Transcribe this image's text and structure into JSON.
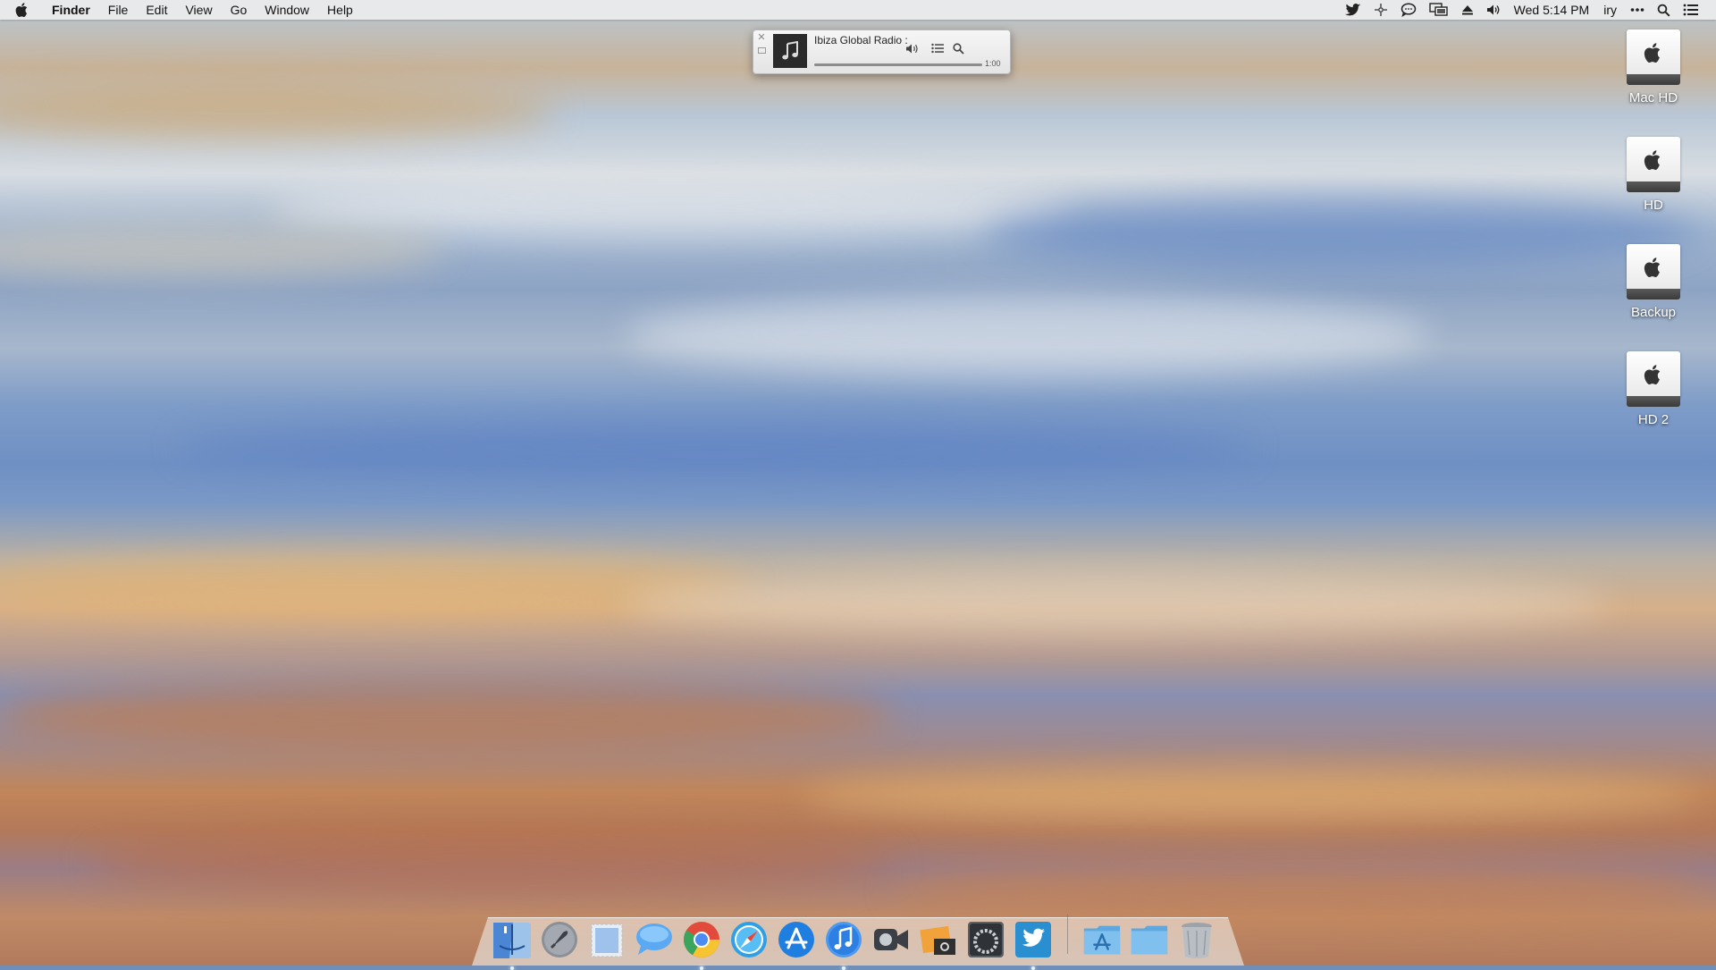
{
  "menubar": {
    "app_name": "Finder",
    "menus": [
      "File",
      "Edit",
      "View",
      "Go",
      "Window",
      "Help"
    ],
    "clock": "Wed 5:14 PM",
    "user": "iry"
  },
  "status_icons": [
    "twitter-icon",
    "scanner-icon",
    "messages-icon",
    "display-icon",
    "eject-icon",
    "volume-icon"
  ],
  "mini_player": {
    "title": "Ibiza Global Radio :",
    "time": "1:00",
    "progress": 1.0
  },
  "desktop_icons": [
    {
      "label": "Mac HD"
    },
    {
      "label": "HD"
    },
    {
      "label": "Backup"
    },
    {
      "label": "HD 2"
    }
  ],
  "dock_items": [
    {
      "name": "finder-icon",
      "running": true
    },
    {
      "name": "launchpad-icon",
      "running": false
    },
    {
      "name": "preview-icon",
      "running": false
    },
    {
      "name": "messages-icon",
      "running": false
    },
    {
      "name": "chrome-icon",
      "running": true
    },
    {
      "name": "safari-icon",
      "running": false
    },
    {
      "name": "app-store-icon",
      "running": false
    },
    {
      "name": "itunes-icon",
      "running": true
    },
    {
      "name": "facetime-icon",
      "running": false
    },
    {
      "name": "image-capture-icon",
      "running": false
    },
    {
      "name": "system-preferences-icon",
      "running": false
    },
    {
      "name": "twitter-icon",
      "running": true
    },
    {
      "name": "applications-folder-icon",
      "running": false
    },
    {
      "name": "documents-folder-icon",
      "running": false
    },
    {
      "name": "trash-icon",
      "running": false
    }
  ],
  "colors": {
    "menubar_bg": "#ececec",
    "wallpaper_blue": "#6f90c4",
    "wallpaper_orange": "#c1865a"
  }
}
